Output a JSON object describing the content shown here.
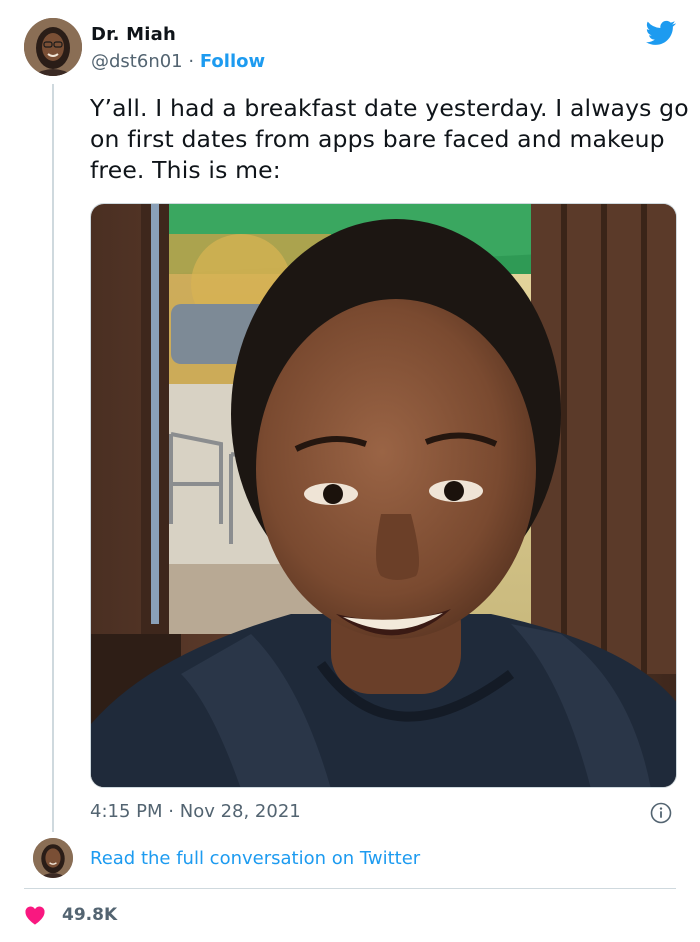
{
  "author": {
    "name": "Dr. Miah",
    "handle": "@dst6n01",
    "separator": "·",
    "follow_label": "Follow"
  },
  "tweet": {
    "text": "Y’all. I had a breakfast date yesterday. I always go on first dates from apps bare faced and makeup free. This is me:",
    "time": "4:15 PM",
    "date": "Nov 28, 2021",
    "read_full_label": "Read the full conversation on Twitter",
    "like_count": "49.8K"
  },
  "icons": {
    "brand": "twitter-bird-icon",
    "info": "info-icon",
    "like": "heart-icon"
  },
  "colors": {
    "accent": "#1d9bf0",
    "like": "#f91880",
    "secondary_text": "#536471",
    "divider": "#cfd9de"
  }
}
